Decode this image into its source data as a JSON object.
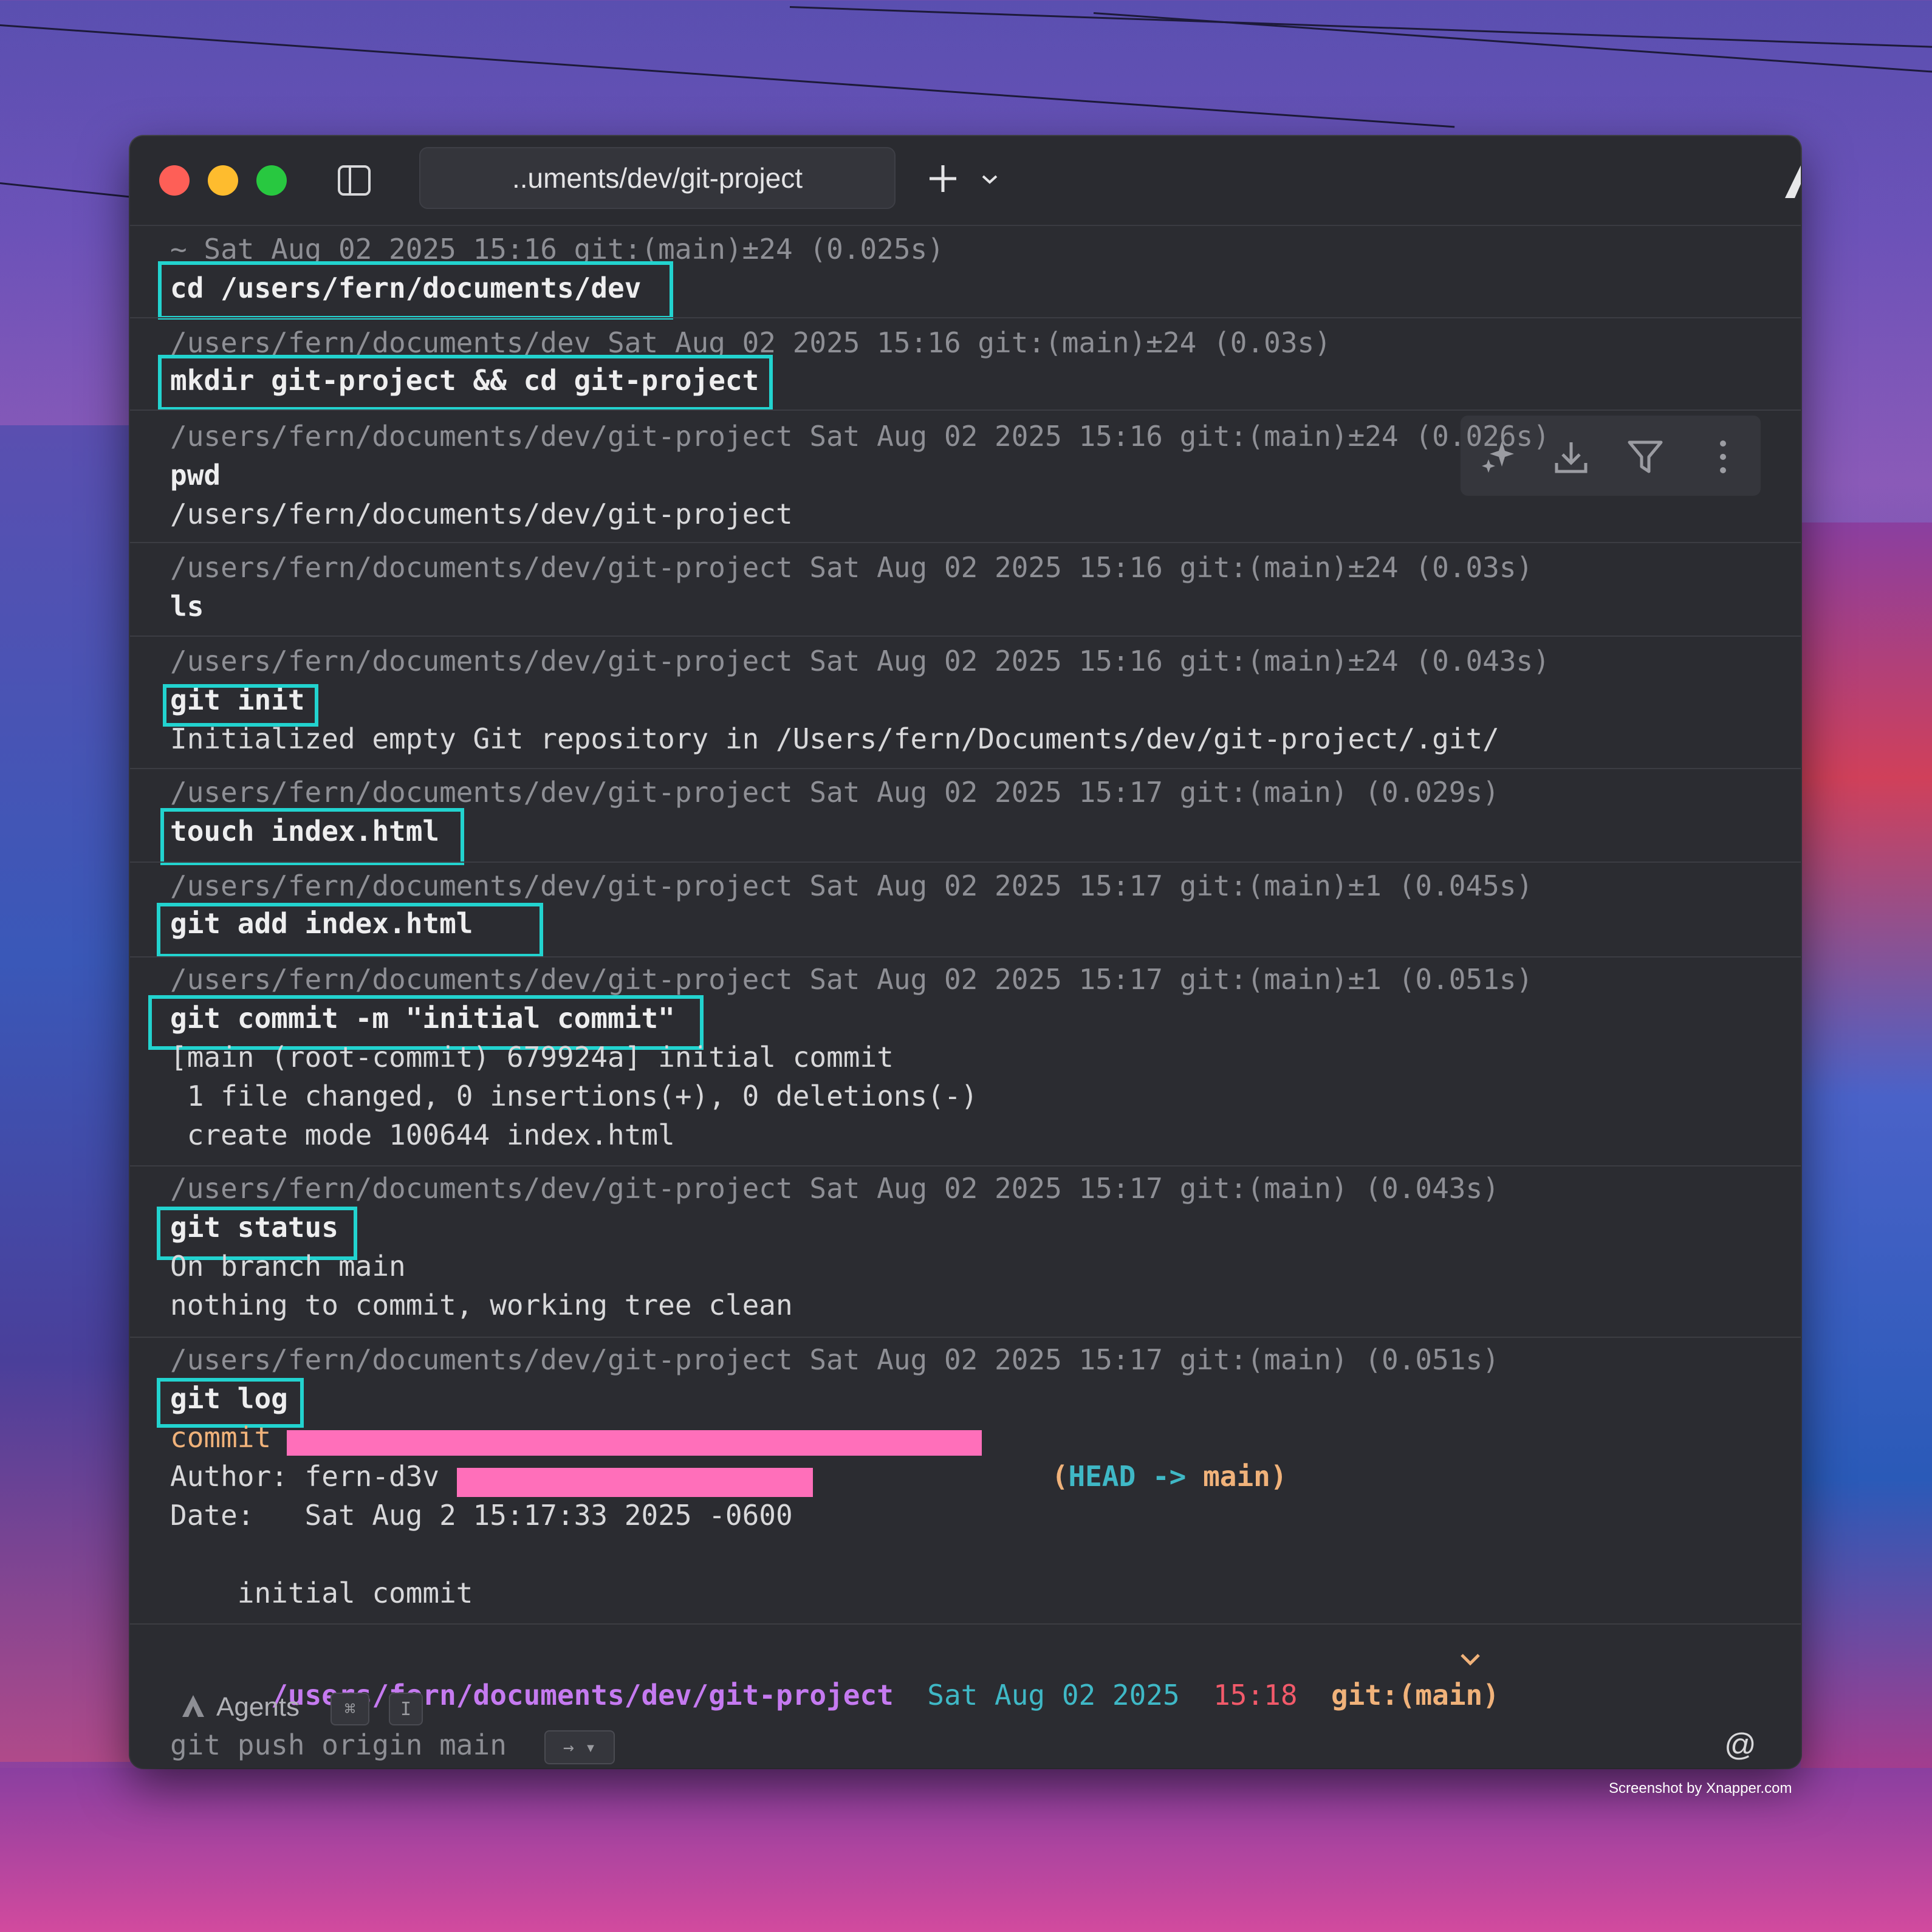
{
  "window": {
    "tab_title": "..uments/dev/git-project",
    "avatar_alt": "user avatar"
  },
  "blocks": [
    {
      "meta": "~ Sat Aug 02 2025 15:16 git:(main)±24 (0.025s)",
      "command": "cd /users/fern/documents/dev",
      "output": []
    },
    {
      "meta": "/users/fern/documents/dev Sat Aug 02 2025 15:16 git:(main)±24 (0.03s)",
      "command": "mkdir git-project && cd git-project",
      "output": []
    },
    {
      "meta": "/users/fern/documents/dev/git-project Sat Aug 02 2025 15:16 git:(main)±24 (0.026s)",
      "command": "pwd",
      "output": [
        "/users/fern/documents/dev/git-project"
      ]
    },
    {
      "meta": "/users/fern/documents/dev/git-project Sat Aug 02 2025 15:16 git:(main)±24 (0.03s)",
      "command": "ls",
      "output": []
    },
    {
      "meta": "/users/fern/documents/dev/git-project Sat Aug 02 2025 15:16 git:(main)±24 (0.043s)",
      "command": "git init",
      "output": [
        "Initialized empty Git repository in /Users/fern/Documents/dev/git-project/.git/"
      ]
    },
    {
      "meta": "/users/fern/documents/dev/git-project Sat Aug 02 2025 15:17 git:(main) (0.029s)",
      "command": "touch index.html",
      "output": []
    },
    {
      "meta": "/users/fern/documents/dev/git-project Sat Aug 02 2025 15:17 git:(main)±1 (0.045s)",
      "command": "git add index.html",
      "output": []
    },
    {
      "meta": "/users/fern/documents/dev/git-project Sat Aug 02 2025 15:17 git:(main)±1 (0.051s)",
      "command": "git commit -m \"initial commit\"",
      "output": [
        "[main (root-commit) 679924a] initial commit",
        " 1 file changed, 0 insertions(+), 0 deletions(-)",
        " create mode 100644 index.html"
      ]
    },
    {
      "meta": "/users/fern/documents/dev/git-project Sat Aug 02 2025 15:17 git:(main) (0.043s)",
      "command": "git status",
      "output": [
        "On branch main",
        "nothing to commit, working tree clean"
      ]
    },
    {
      "meta": "/users/fern/documents/dev/git-project Sat Aug 02 2025 15:17 git:(main) (0.051s)",
      "command": "git log",
      "output": []
    }
  ],
  "git_log": {
    "commit_label": "commit",
    "head_open": "(",
    "head_ref": "HEAD ->",
    "branch": "main",
    "head_close": ")",
    "author_label": "Author: fern-d3v",
    "date_line": "Date:   Sat Aug 2 15:17:33 2025 -0600",
    "message": "    initial commit"
  },
  "prompt": {
    "path": "/users/fern/documents/dev/git-project",
    "date": "Sat Aug 02 2025",
    "time": "15:18",
    "git": "git:(main)",
    "agents_label": "Agents",
    "shortcut_key1": "⌘",
    "shortcut_key2": "I",
    "suggestion": "git push origin main",
    "accept_key": "→ ▾",
    "mention_icon": "@"
  },
  "colors": {
    "highlight": "#22d3cf",
    "path": "#c57af0",
    "date": "#3fb8c6",
    "time": "#f25a6a",
    "git": "#f0b27a",
    "redaction": "#ff6fba"
  },
  "credit": "Screenshot by Xnapper.com"
}
